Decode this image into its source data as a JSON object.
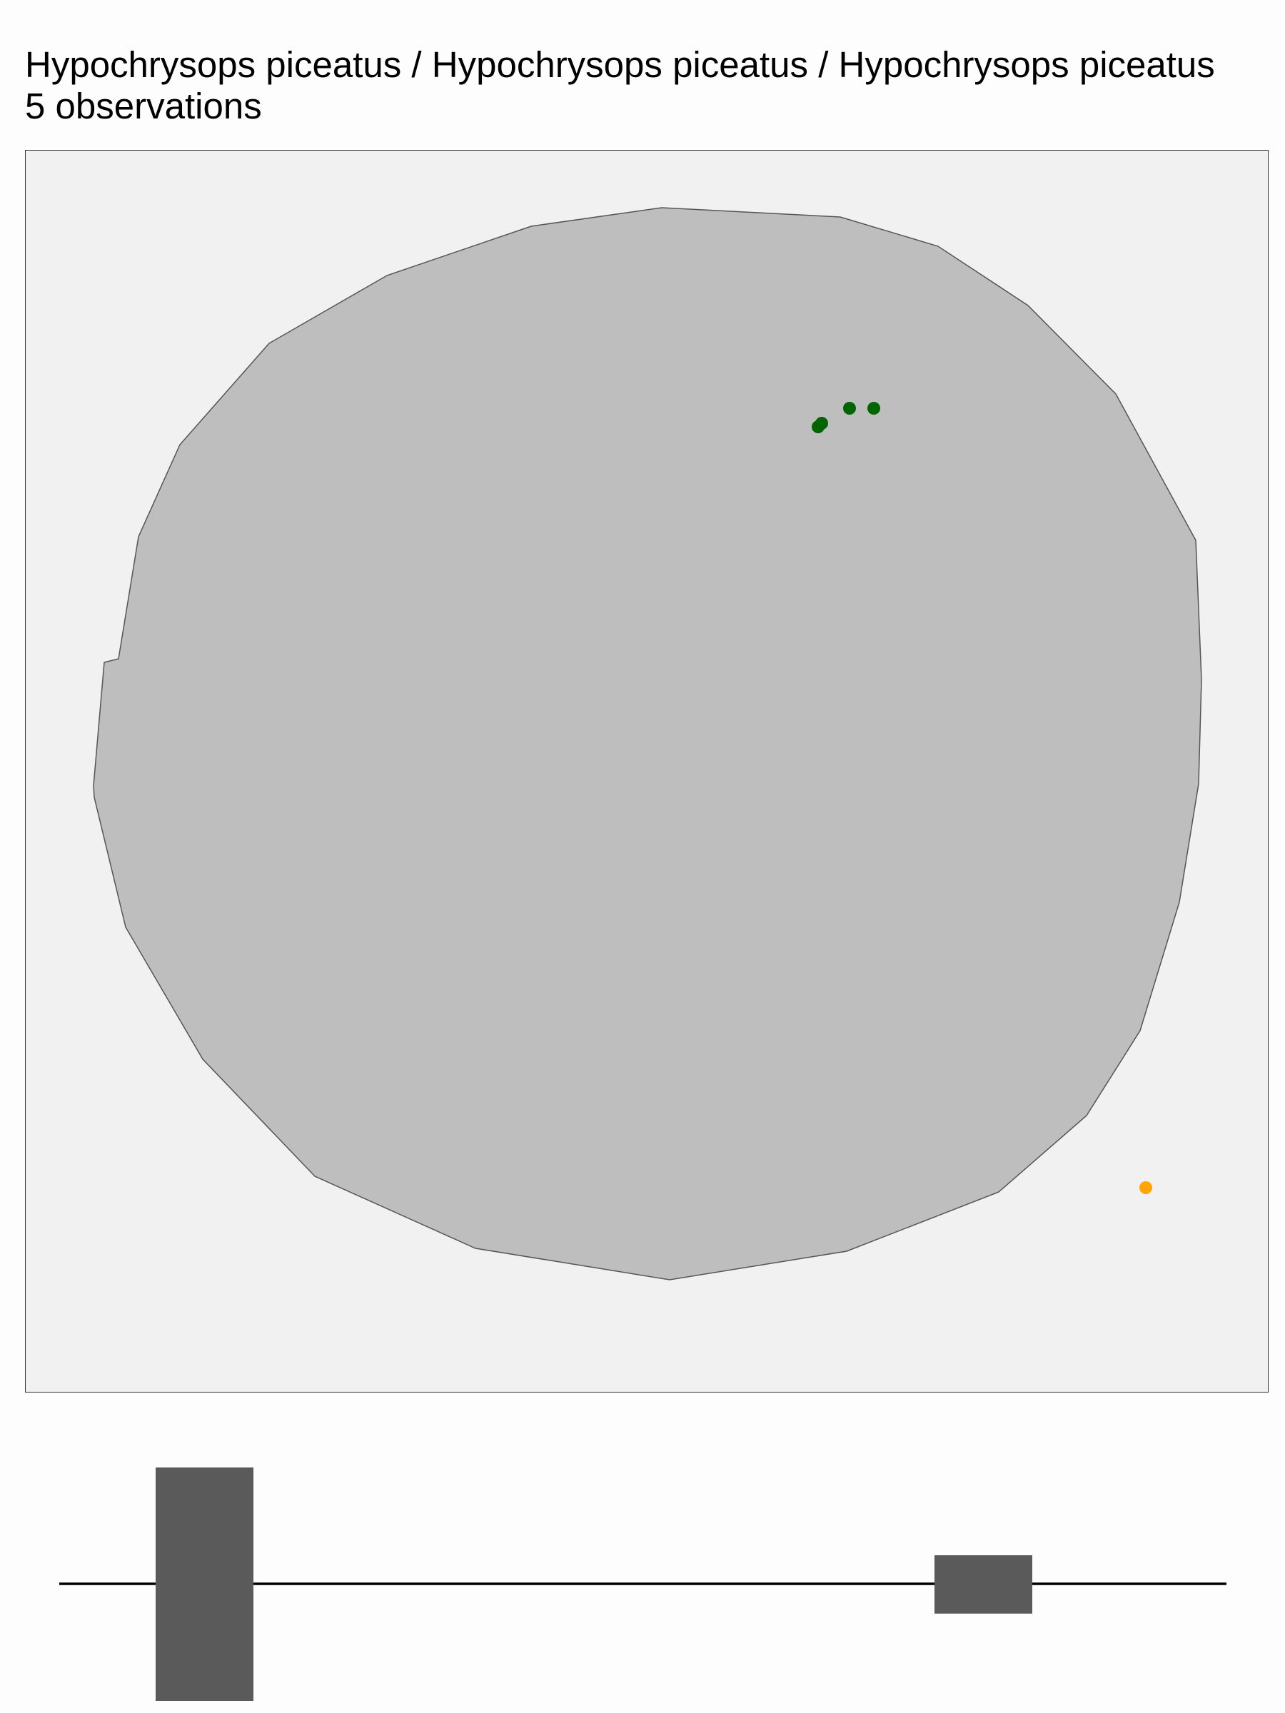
{
  "title": "Hypochrysops piceatus / Hypochrysops piceatus / Hypochrysops piceatus",
  "subtitle": "5 observations",
  "colors": {
    "background": "#fdfdfd",
    "panel": "#f1f1f1",
    "land": "#bebebe",
    "land_outline": "#555555",
    "observation": "#006400",
    "outlier": "#ffa500",
    "bar": "#5a5a5a"
  },
  "map": {
    "region_shape": "single landmass polygon",
    "observations": [
      {
        "label": "obs-1",
        "color_key": "observation"
      },
      {
        "label": "obs-2",
        "color_key": "observation"
      },
      {
        "label": "obs-3",
        "color_key": "observation"
      },
      {
        "label": "obs-4",
        "color_key": "observation"
      },
      {
        "label": "obs-5",
        "color_key": "outlier"
      }
    ]
  },
  "timeline": {
    "bars": [
      {
        "label": "group-1",
        "relative_count": 1.0
      },
      {
        "label": "group-2",
        "relative_count": 0.25
      }
    ]
  }
}
